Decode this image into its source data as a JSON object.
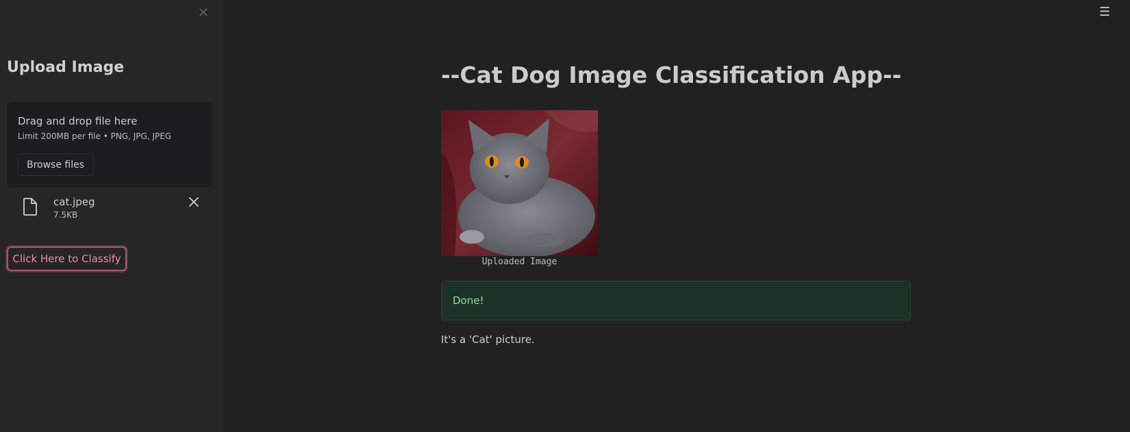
{
  "sidebar": {
    "title": "Upload Image",
    "close_icon": "close-icon",
    "uploader": {
      "title": "Drag and drop file here",
      "limit": "Limit 200MB per file • PNG, JPG, JPEG",
      "browse_label": "Browse files"
    },
    "file": {
      "name": "cat.jpeg",
      "size": "7.5KB",
      "icon": "file-icon",
      "remove_icon": "close-icon"
    },
    "classify_label": "Click Here to Classify"
  },
  "header": {
    "menu_icon": "hamburger-menu-icon"
  },
  "main": {
    "title": "--Cat Dog Image Classification App--",
    "image_caption": "Uploaded Image",
    "success_message": "Done!",
    "result": "It's a 'Cat' picture."
  },
  "colors": {
    "accent": "#ff4b4b",
    "classify_border": "#b5537b",
    "success_bg": "#1b3227",
    "success_text": "#8be59a"
  }
}
